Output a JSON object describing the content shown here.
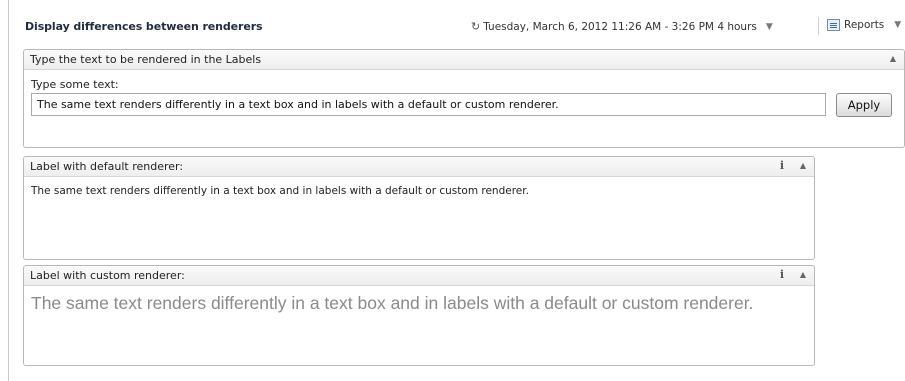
{
  "header": {
    "title": "Display differences between renderers",
    "time_range": "Tuesday, March 6, 2012 11:26 AM - 3:26 PM 4 hours",
    "reports_label": "Reports"
  },
  "input_panel": {
    "title": "Type the text to be rendered in the Labels",
    "field_label": "Type some text:",
    "field_value": "The same text renders differently in a text box and in labels with a default or custom renderer.",
    "apply_label": "Apply"
  },
  "default_panel": {
    "title": "Label with default renderer:",
    "content": "The same text renders differently in a text box and in labels with a default or custom renderer."
  },
  "custom_panel": {
    "title": "Label with custom renderer:",
    "content": "The same text renders differently in a text box and in labels with a default or custom renderer."
  },
  "icons": {
    "clock": "clock-icon",
    "dropdown": "chevron-down-icon",
    "report": "report-icon",
    "info": "info-icon",
    "collapse": "collapse-up-icon"
  }
}
